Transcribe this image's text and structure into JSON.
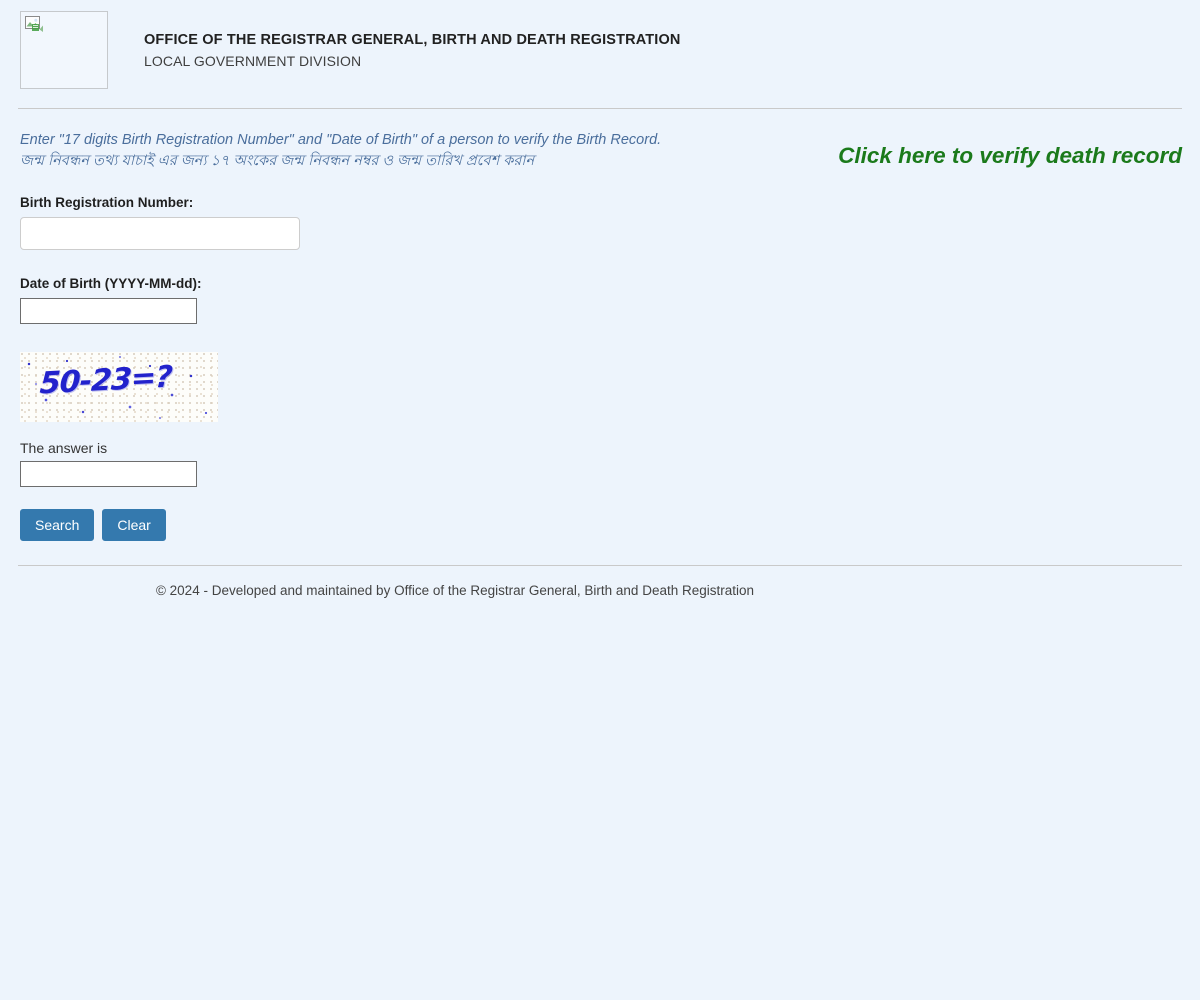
{
  "header": {
    "logo_alt": "broken-image",
    "title": "OFFICE OF THE REGISTRAR GENERAL, BIRTH AND DEATH REGISTRATION",
    "subtitle": "LOCAL GOVERNMENT DIVISION"
  },
  "intro": {
    "english": "Enter \"17 digits Birth Registration Number\" and \"Date of Birth\" of a person to verify the Birth Record.",
    "bangla": "জন্ম নিবন্ধন তথ্য যাচাই এর জন্য ১৭ অংকের জন্ম নিবন্ধন নম্বর ও জন্ম তারিখ প্রবেশ করান"
  },
  "death_link": {
    "label": "Click here to verify death record",
    "color": "#1b7a1b"
  },
  "form": {
    "brn": {
      "label": "Birth Registration Number:",
      "value": "",
      "placeholder": ""
    },
    "dob": {
      "label": "Date of Birth (YYYY-MM-dd):",
      "value": "",
      "placeholder": ""
    },
    "captcha": {
      "question": "50-23=?",
      "answer_label": "The answer is",
      "answer_value": "",
      "answer_placeholder": "",
      "text_color": "#2222cc"
    },
    "buttons": {
      "search": "Search",
      "clear": "Clear",
      "accent_color": "#3479ae"
    }
  },
  "footer": {
    "text": "© 2024 - Developed and maintained by Office of the Registrar General, Birth and Death Registration"
  },
  "theme": {
    "page_background": "#edf4fc",
    "intro_text_color": "#4a6e9c",
    "rule_color": "#c9c9c9"
  }
}
